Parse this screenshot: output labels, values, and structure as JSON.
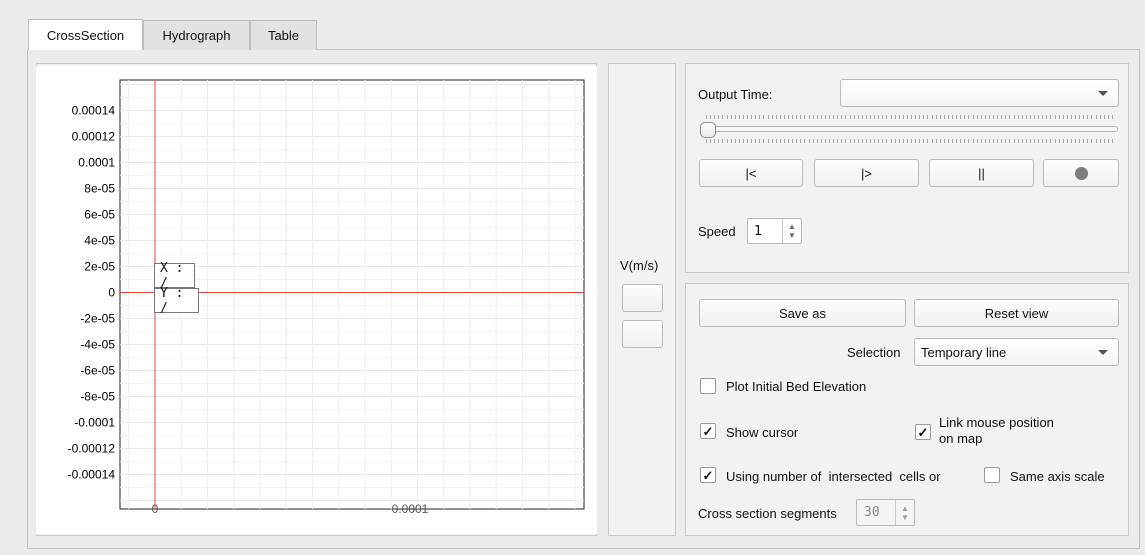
{
  "tabs": [
    {
      "label": "CrossSection",
      "active": true
    },
    {
      "label": "Hydrograph",
      "active": false
    },
    {
      "label": "Table",
      "active": false
    }
  ],
  "plot": {
    "y_ticks": [
      "0.00014",
      "0.00012",
      "0.0001",
      "8e-05",
      "6e-05",
      "4e-05",
      "2e-05",
      "0",
      "-2e-05",
      "-4e-05",
      "-6e-05",
      "-8e-05",
      "-0.0001",
      "-0.00012",
      "-0.00014"
    ],
    "x_ticks": [
      "0",
      "0.0001"
    ],
    "cursor_x": "X : /",
    "cursor_y": "Y : /",
    "cursor_color": "#e0473a"
  },
  "velocity": {
    "label": "V(m/s)"
  },
  "playback": {
    "output_time_label": "Output Time:",
    "output_time_value": "",
    "btn_first": "|<",
    "btn_play": "|>",
    "btn_pause": "||",
    "speed_label": "Speed",
    "speed_value": "1",
    "slider_value": 0
  },
  "options": {
    "save_as": "Save as",
    "reset_view": "Reset view",
    "selection_label": "Selection",
    "selection_value": "Temporary line",
    "plot_initial_bed": {
      "label": "Plot Initial Bed Elevation",
      "checked": false
    },
    "show_cursor": {
      "label": "Show cursor",
      "checked": true
    },
    "link_mouse": {
      "label_line1": "Link mouse position",
      "label_line2": "on map",
      "checked": true
    },
    "using_number": {
      "label": "Using number of  intersected  cells or",
      "checked": true
    },
    "same_axis": {
      "label": "Same axis scale",
      "checked": false
    },
    "segments_label": "Cross section segments",
    "segments_value": "30"
  }
}
